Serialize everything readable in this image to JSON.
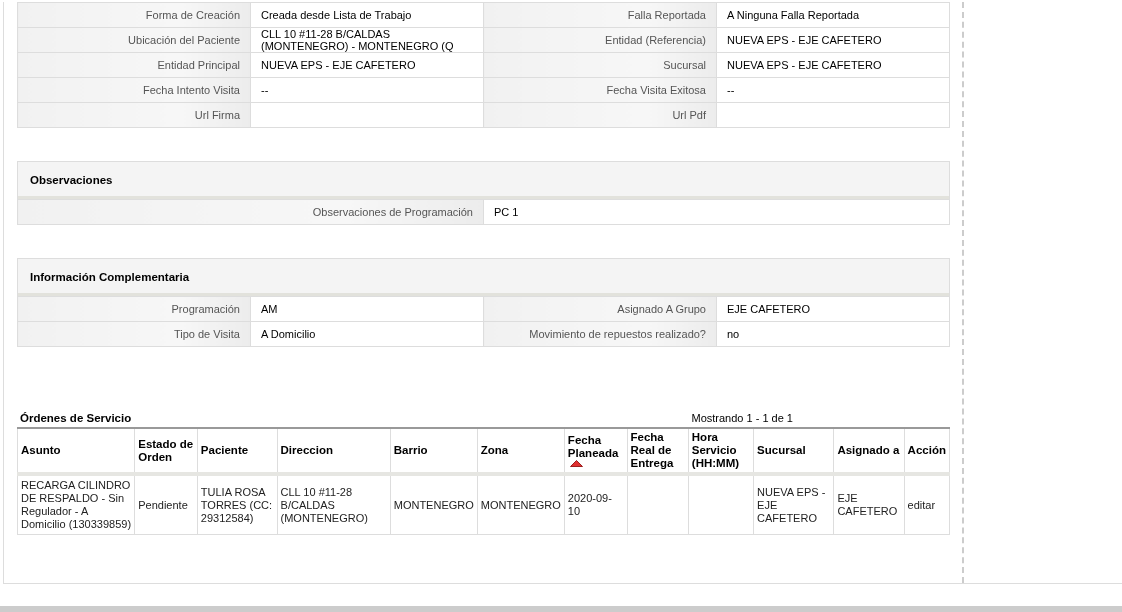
{
  "details": {
    "rows": [
      {
        "label_1": "Forma de Creación",
        "value_1": "Creada desde Lista de Trabajo",
        "label_2": "Falla Reportada",
        "value_2": "A Ninguna Falla Reportada"
      },
      {
        "label_1": "Ubicación del Paciente",
        "value_1": "CLL 10 #11-28 B/CALDAS (MONTENEGRO) - MONTENEGRO (Q",
        "label_2": "Entidad (Referencia)",
        "value_2": "NUEVA EPS - EJE CAFETERO"
      },
      {
        "label_1": "Entidad Principal",
        "value_1": "NUEVA EPS - EJE CAFETERO",
        "label_2": "Sucursal",
        "value_2": "NUEVA EPS - EJE CAFETERO"
      },
      {
        "label_1": "Fecha Intento Visita",
        "value_1": "--",
        "label_2": "Fecha Visita Exitosa",
        "value_2": "--"
      },
      {
        "label_1": "Url Firma",
        "label_2": "Url Pdf"
      }
    ]
  },
  "observaciones": {
    "title": "Observaciones",
    "rows": [
      {
        "label": "Observaciones de Programación",
        "value": "PC 1"
      }
    ]
  },
  "informacion_complementaria": {
    "title": "Información Complementaria",
    "rows": [
      {
        "label_1": "Programación",
        "value_1": "AM",
        "label_2": "Asignado A Grupo",
        "value_2": "EJE CAFETERO"
      },
      {
        "label_1": "Tipo de Visita",
        "value_1": "A Domicilio",
        "label_2": "Movimiento de repuestos realizado?",
        "value_2": "no"
      }
    ]
  },
  "ordenes": {
    "title": "Órdenes de Servicio",
    "pagination": "Mostrando 1 - 1 de 1",
    "columns": [
      {
        "label": "Asunto",
        "sorted": false
      },
      {
        "label": "Estado de Orden",
        "sorted": false
      },
      {
        "label": "Paciente",
        "sorted": false
      },
      {
        "label": "Direccion",
        "sorted": false
      },
      {
        "label": "Barrio",
        "sorted": false
      },
      {
        "label": "Zona",
        "sorted": false
      },
      {
        "label": "Fecha Planeada",
        "sorted": true
      },
      {
        "label": "Fecha Real de Entrega",
        "sorted": false
      },
      {
        "label": "Hora Servicio (HH:MM)",
        "sorted": false
      },
      {
        "label": "Sucursal",
        "sorted": false
      },
      {
        "label": "Asignado a",
        "sorted": false
      },
      {
        "label": "Acción",
        "sorted": false
      }
    ],
    "rows": [
      {
        "cells": [
          "RECARGA CILINDRO DE RESPALDO - Sin Regulador - A Domicilio (130339859)",
          "Pendiente",
          "TULIA ROSA TORRES (CC: 29312584)",
          "CLL 10 #11-28 B/CALDAS (MONTENEGRO)",
          "MONTENEGRO",
          "MONTENEGRO",
          "2020-09-10",
          "",
          "",
          "NUEVA EPS - EJE CAFETERO",
          "EJE CAFETERO"
        ],
        "action": "editar"
      }
    ]
  }
}
